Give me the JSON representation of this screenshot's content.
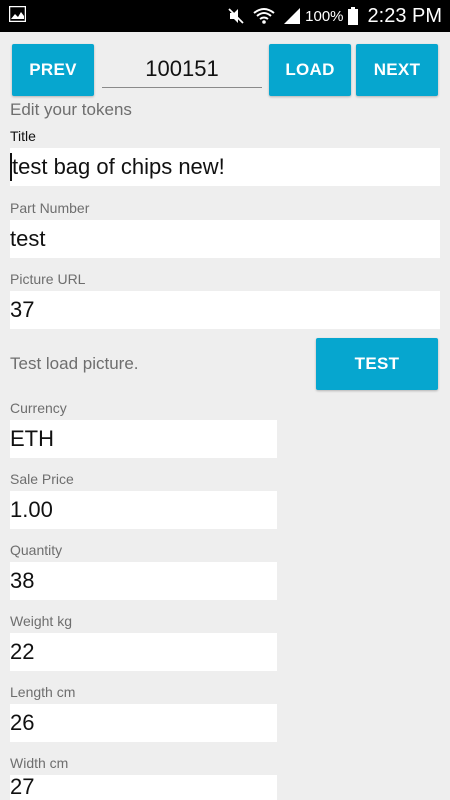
{
  "status_bar": {
    "battery_percent": "100%",
    "time": "2:23 PM"
  },
  "toolbar": {
    "prev_label": "PREV",
    "record_id": "100151",
    "load_label": "LOAD",
    "next_label": "NEXT"
  },
  "form": {
    "heading": "Edit your tokens",
    "title": {
      "label": "Title",
      "value": "test bag of chips new!"
    },
    "part_number": {
      "label": "Part Number",
      "value": "test"
    },
    "picture_url": {
      "label": "Picture URL",
      "value": "37"
    },
    "test_picture": {
      "description": "Test load picture.",
      "button_label": "TEST"
    },
    "currency": {
      "label": "Currency",
      "value": "ETH"
    },
    "sale_price": {
      "label": "Sale Price",
      "value": "1.00"
    },
    "quantity": {
      "label": "Quantity",
      "value": "38"
    },
    "weight": {
      "label": "Weight kg",
      "value": "22"
    },
    "length": {
      "label": "Length cm",
      "value": "26"
    },
    "width": {
      "label": "Width cm",
      "value": "27"
    }
  },
  "colors": {
    "accent": "#06a6cf",
    "background": "#eeeeee",
    "field_background": "#ffffff"
  }
}
